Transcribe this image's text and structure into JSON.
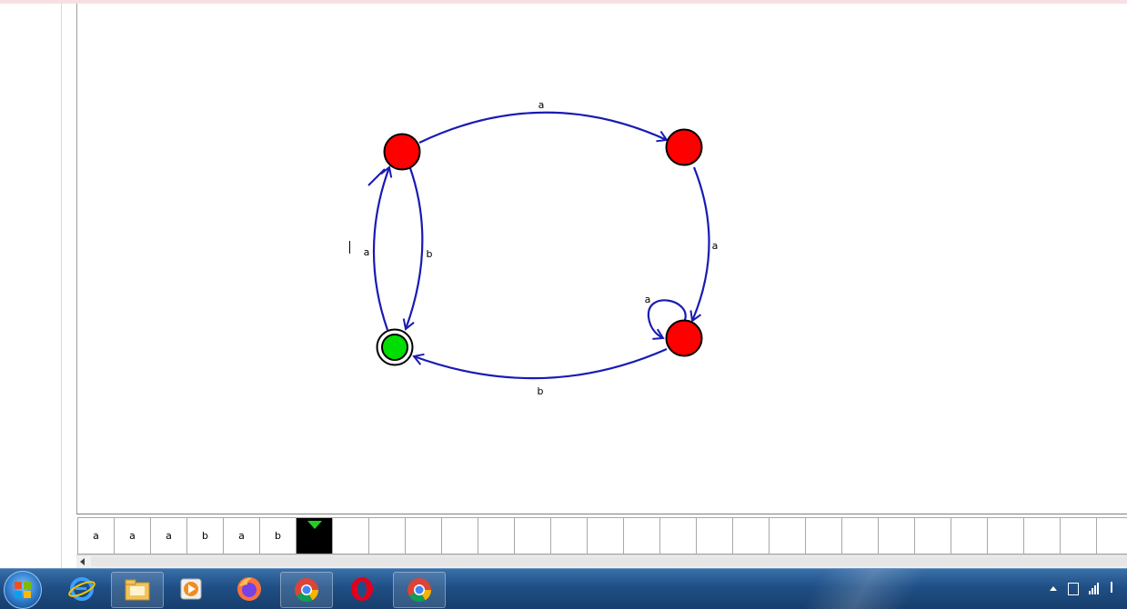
{
  "automaton": {
    "states": [
      {
        "id": "q0",
        "type": "normal",
        "color": "#ff0000"
      },
      {
        "id": "q1",
        "type": "normal",
        "color": "#ff0000"
      },
      {
        "id": "q2",
        "type": "normal",
        "color": "#ff0000"
      },
      {
        "id": "q3",
        "type": "accepting",
        "active": true,
        "color": "#00dd00"
      }
    ],
    "transitions": [
      {
        "from": "q0",
        "to": "q1",
        "symbol": "a"
      },
      {
        "from": "q1",
        "to": "q2",
        "symbol": "a"
      },
      {
        "from": "q2",
        "to": "q2",
        "symbol": "a"
      },
      {
        "from": "q2",
        "to": "q3",
        "symbol": "b"
      },
      {
        "from": "q0",
        "to": "q3",
        "symbol": "b"
      },
      {
        "from": "q3",
        "to": "q0",
        "symbol": "a"
      }
    ],
    "edge_color": "#1a1ab4"
  },
  "tape": {
    "cells": [
      "a",
      "a",
      "a",
      "b",
      "a",
      "b",
      "",
      "",
      "",
      "",
      "",
      "",
      "",
      "",
      "",
      "",
      "",
      "",
      "",
      "",
      "",
      "",
      "",
      "",
      "",
      "",
      "",
      "",
      ""
    ],
    "head_index": 6,
    "head_color": "#1fd11f"
  },
  "taskbar": {
    "apps": [
      "start-button",
      "internet-explorer-icon",
      "file-explorer-icon",
      "media-player-icon",
      "firefox-icon",
      "chrome-icon",
      "opera-icon",
      "chrome-icon"
    ]
  }
}
